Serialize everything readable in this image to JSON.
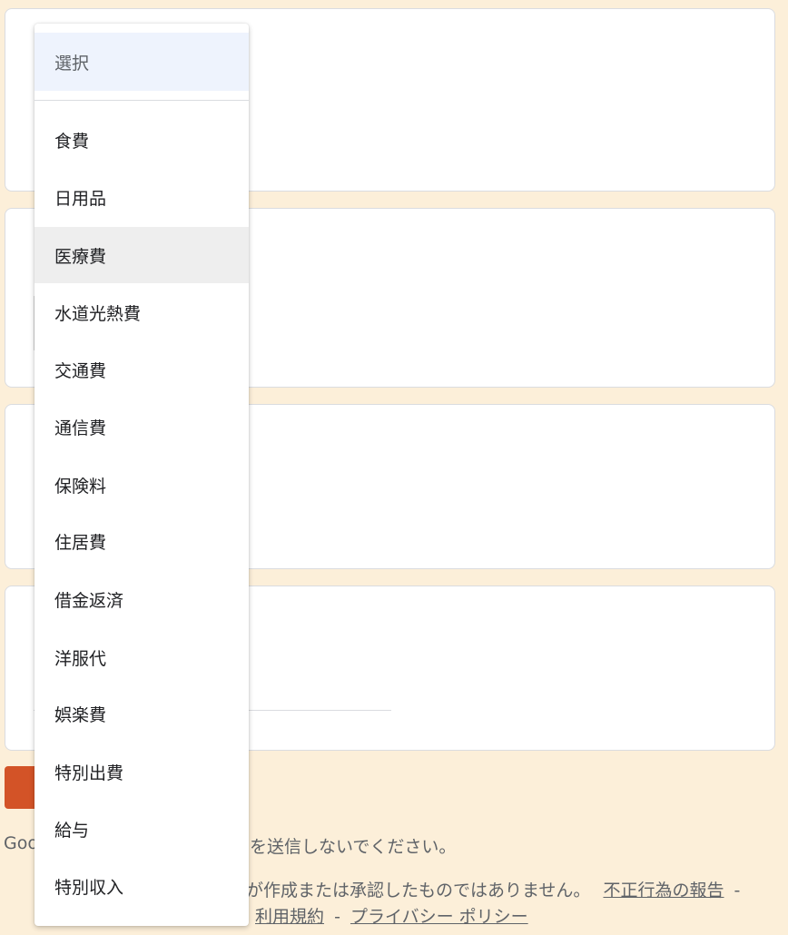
{
  "colors": {
    "page_background": "#fcefd9",
    "card_background": "#ffffff",
    "accent": "#d35327",
    "selected_option_background": "#eef3fd",
    "hover_option_background": "#eeeeee"
  },
  "dropdown": {
    "selected_label": "選択",
    "hovered_label": "医療費",
    "options": [
      "食費",
      "日用品",
      "医療費",
      "水道光熱費",
      "交通費",
      "通信費",
      "保険料",
      "住居費",
      "借金返済",
      "洋服代",
      "娯楽費",
      "特別出費",
      "給与",
      "特別収入"
    ]
  },
  "footer": {
    "warning_prefix": "Goo",
    "warning_tail": "を送信しないでください。",
    "disclaimer": "が作成または承認したものではありません。",
    "report_link": "不正行為の報告",
    "separator": "-",
    "terms_link": "利用規約",
    "privacy_link": "プライバシー ポリシー"
  }
}
